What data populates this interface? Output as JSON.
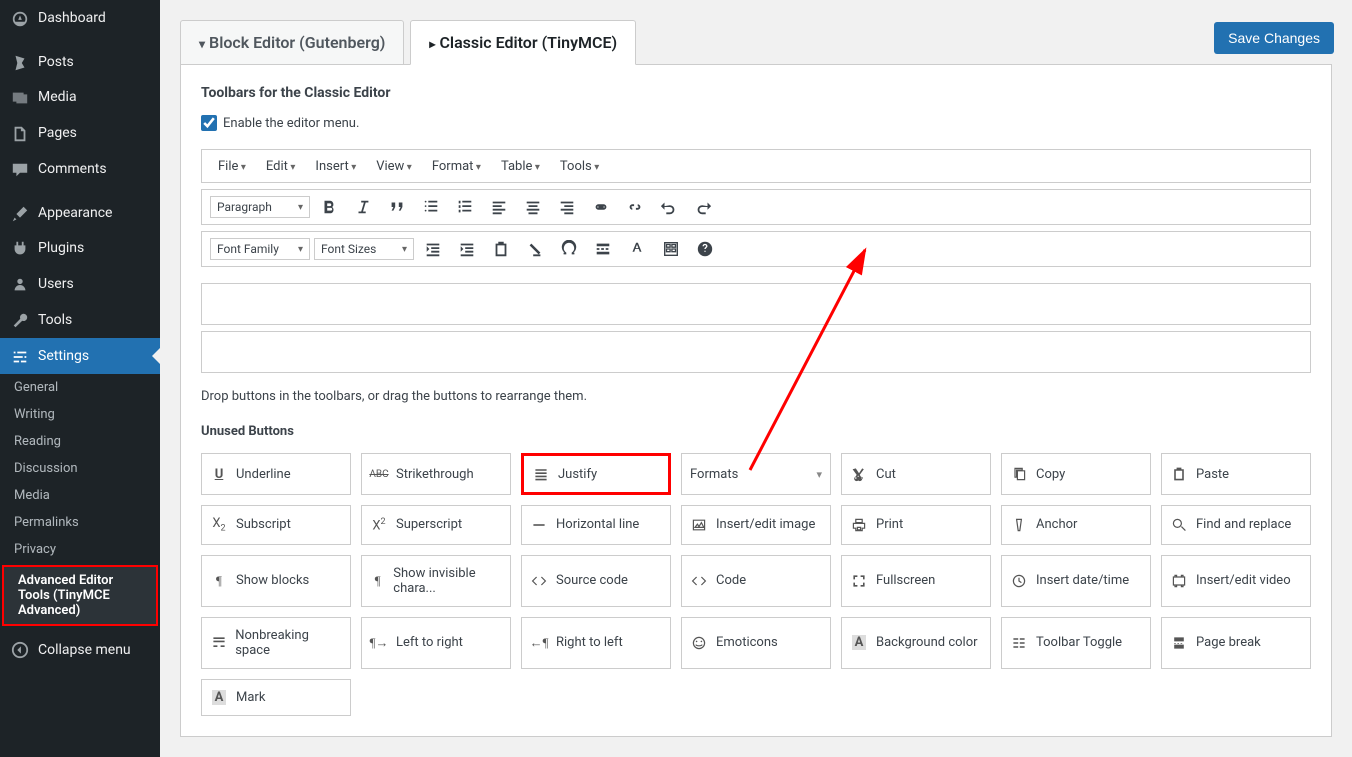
{
  "sidebar": {
    "items": [
      {
        "key": "dashboard",
        "label": "Dashboard"
      },
      {
        "key": "posts",
        "label": "Posts"
      },
      {
        "key": "media",
        "label": "Media"
      },
      {
        "key": "pages",
        "label": "Pages"
      },
      {
        "key": "comments",
        "label": "Comments"
      },
      {
        "key": "appearance",
        "label": "Appearance"
      },
      {
        "key": "plugins",
        "label": "Plugins"
      },
      {
        "key": "users",
        "label": "Users"
      },
      {
        "key": "tools",
        "label": "Tools"
      },
      {
        "key": "settings",
        "label": "Settings"
      }
    ],
    "subitems": [
      {
        "label": "General"
      },
      {
        "label": "Writing"
      },
      {
        "label": "Reading"
      },
      {
        "label": "Discussion"
      },
      {
        "label": "Media"
      },
      {
        "label": "Permalinks"
      },
      {
        "label": "Privacy"
      },
      {
        "label": "Advanced Editor Tools (TinyMCE Advanced)"
      }
    ],
    "collapse": "Collapse menu"
  },
  "tabs": {
    "block": "Block Editor (Gutenberg)",
    "classic": "Classic Editor (TinyMCE)"
  },
  "save_label": "Save Changes",
  "section_title": "Toolbars for the Classic Editor",
  "enable_menu_label": "Enable the editor menu.",
  "menu_items": [
    "File",
    "Edit",
    "Insert",
    "View",
    "Format",
    "Table",
    "Tools"
  ],
  "row1": {
    "paragraph": "Paragraph"
  },
  "row2": {
    "fontfamily": "Font Family",
    "fontsizes": "Font Sizes"
  },
  "drop_hint": "Drop buttons in the toolbars, or drag the buttons to rearrange them.",
  "unused_title": "Unused Buttons",
  "unused": [
    [
      {
        "key": "underline",
        "label": "Underline",
        "icon": "U"
      },
      {
        "key": "strikethrough",
        "label": "Strikethrough",
        "icon": "abc"
      },
      {
        "key": "justify",
        "label": "Justify",
        "icon": "justify",
        "highlight": true
      },
      {
        "key": "formats",
        "label": "Formats",
        "dropdown": true
      },
      {
        "key": "cut",
        "label": "Cut",
        "icon": "cut"
      },
      {
        "key": "copy",
        "label": "Copy",
        "icon": "copy"
      },
      {
        "key": "paste",
        "label": "Paste",
        "icon": "paste"
      }
    ],
    [
      {
        "key": "subscript",
        "label": "Subscript",
        "icon": "x2d"
      },
      {
        "key": "superscript",
        "label": "Superscript",
        "icon": "x2u"
      },
      {
        "key": "hr",
        "label": "Horizontal line",
        "icon": "hr"
      },
      {
        "key": "image",
        "label": "Insert/edit image",
        "icon": "image"
      },
      {
        "key": "print",
        "label": "Print",
        "icon": "print"
      },
      {
        "key": "anchor",
        "label": "Anchor",
        "icon": "anchor"
      },
      {
        "key": "findreplace",
        "label": "Find and replace",
        "icon": "find"
      }
    ],
    [
      {
        "key": "showblocks",
        "label": "Show blocks",
        "icon": "pil"
      },
      {
        "key": "showinvisible",
        "label": "Show invisible chara...",
        "icon": "pil"
      },
      {
        "key": "sourcecode",
        "label": "Source code",
        "icon": "code"
      },
      {
        "key": "code",
        "label": "Code",
        "icon": "code"
      },
      {
        "key": "fullscreen",
        "label": "Fullscreen",
        "icon": "fullscreen"
      },
      {
        "key": "insertdate",
        "label": "Insert date/time",
        "icon": "clock"
      },
      {
        "key": "insertvideo",
        "label": "Insert/edit video",
        "icon": "video"
      }
    ],
    [
      {
        "key": "nbsp",
        "label": "Nonbreaking space",
        "icon": "nbsp"
      },
      {
        "key": "ltr",
        "label": "Left to right",
        "icon": "pilr"
      },
      {
        "key": "rtl",
        "label": "Right to left",
        "icon": "pill"
      },
      {
        "key": "emoticons",
        "label": "Emoticons",
        "icon": "smile"
      },
      {
        "key": "bgcolor",
        "label": "Background color",
        "icon": "A"
      },
      {
        "key": "toolbartoggle",
        "label": "Toolbar Toggle",
        "icon": "toggle"
      },
      {
        "key": "pagebreak",
        "label": "Page break",
        "icon": "pagebreak"
      }
    ],
    [
      {
        "key": "mark",
        "label": "Mark",
        "icon": "A"
      }
    ]
  ]
}
